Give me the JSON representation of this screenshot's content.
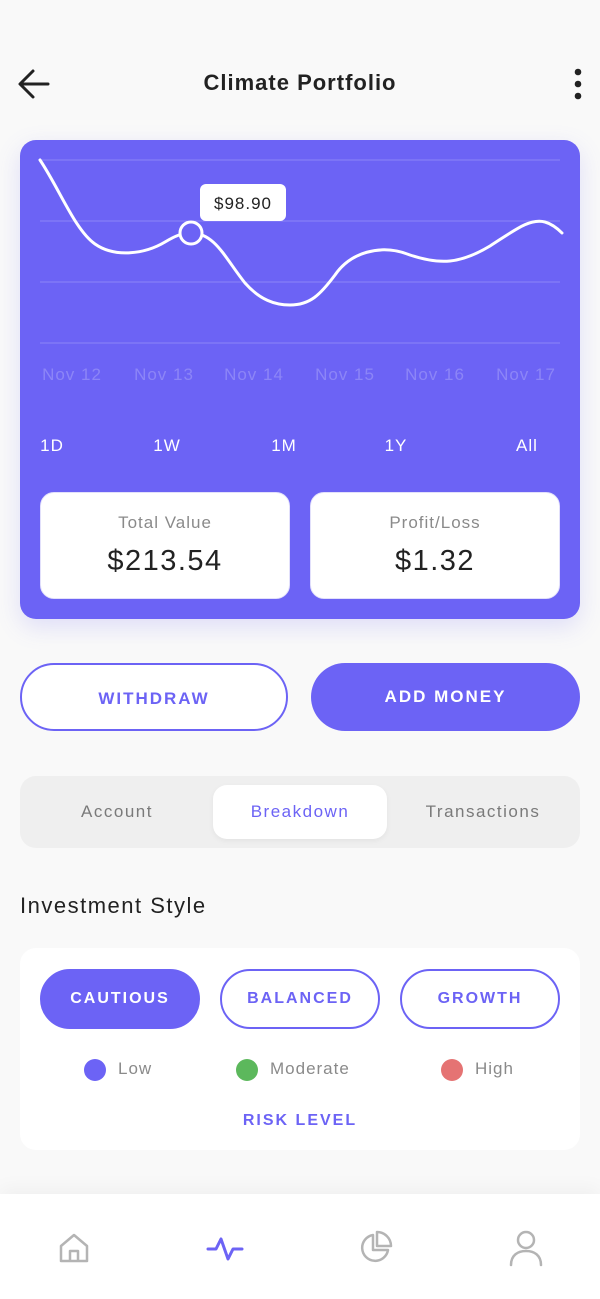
{
  "header": {
    "title": "Climate Portfolio",
    "back_icon": "arrow-left-icon",
    "menu_icon": "more-vertical-icon"
  },
  "chart_data": {
    "type": "line",
    "x": [
      "Nov 12",
      "Nov 13",
      "Nov 14",
      "Nov 15",
      "Nov 16",
      "Nov 17"
    ],
    "tooltip": "$98.90",
    "highlight_index": 1,
    "title": "",
    "xlabel": "",
    "ylabel": "",
    "grid": true,
    "color": "#ffffff"
  },
  "ranges": [
    "1D",
    "1W",
    "1M",
    "1Y",
    "All"
  ],
  "stats": {
    "total_label": "Total Value",
    "total_value": "$213.54",
    "pl_label": "Profit/Loss",
    "pl_value": "$1.32"
  },
  "actions": {
    "withdraw": "WITHDRAW",
    "add_money": "ADD MONEY"
  },
  "tabs": [
    {
      "label": "Account",
      "active": false
    },
    {
      "label": "Breakdown",
      "active": true
    },
    {
      "label": "Transactions",
      "active": false
    }
  ],
  "investment": {
    "title": "Investment Style",
    "options": [
      {
        "label": "CAUTIOUS",
        "selected": true
      },
      {
        "label": "BALANCED",
        "selected": false
      },
      {
        "label": "GROWTH",
        "selected": false
      }
    ],
    "legend": [
      {
        "label": "Low",
        "color": "#6c63f5"
      },
      {
        "label": "Moderate",
        "color": "#5cb85c"
      },
      {
        "label": "High",
        "color": "#e57373"
      }
    ],
    "risk_label": "RISK LEVEL"
  },
  "nav": {
    "items": [
      {
        "icon": "home-icon",
        "active": false
      },
      {
        "icon": "activity-icon",
        "active": true
      },
      {
        "icon": "pie-chart-icon",
        "active": false
      },
      {
        "icon": "user-icon",
        "active": false
      }
    ]
  },
  "colors": {
    "accent": "#6c63f5",
    "inactive_icon": "#b4b4b4",
    "background": "#f9f9f9"
  }
}
